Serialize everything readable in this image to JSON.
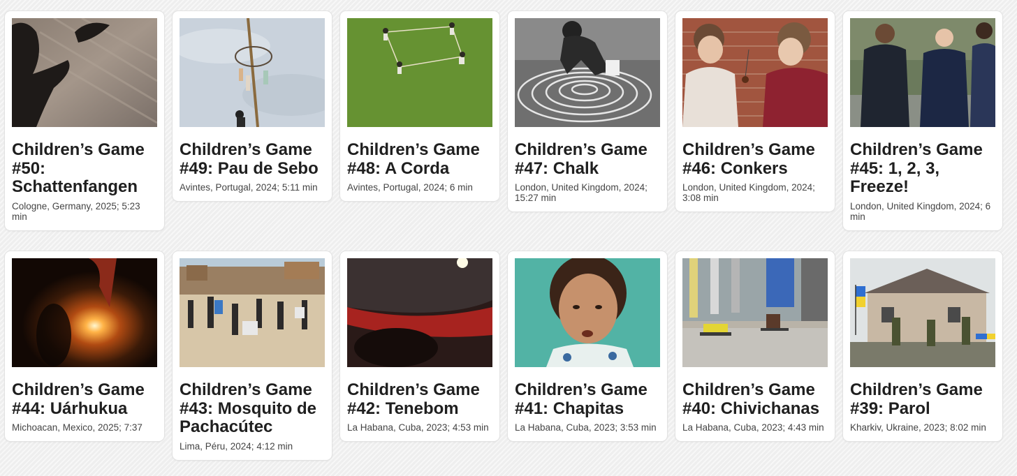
{
  "games": [
    {
      "title": "Children’s Game #50: Schattenfangen",
      "meta": "Cologne, Germany, 2025; 5:23 min",
      "thumbnail": "shadow-on-cobblestones"
    },
    {
      "title": "Children’s Game #49: Pau de Sebo",
      "meta": "Avintes, Portugal, 2024; 5:11 min",
      "thumbnail": "greased-pole-climb"
    },
    {
      "title": "Children’s Game #48: A Corda",
      "meta": "Avintes, Portugal, 2024; 6 min",
      "thumbnail": "rope-game-on-grass"
    },
    {
      "title": "Children’s Game #47: Chalk",
      "meta": "London, United Kingdom, 2024; 15:27 min",
      "thumbnail": "chalk-spiral-drawing"
    },
    {
      "title": "Children’s Game #46: Conkers",
      "meta": "London, United Kingdom, 2024; 3:08 min",
      "thumbnail": "girls-playing-conkers"
    },
    {
      "title": "Children’s Game #45: 1, 2, 3, Freeze!",
      "meta": "London, United Kingdom, 2024; 6 min",
      "thumbnail": "boys-in-school-uniform"
    },
    {
      "title": "Children’s Game #44: Uárhukua",
      "meta": "Michoacan, Mexico, 2025; 7:37",
      "thumbnail": "fireball-at-night"
    },
    {
      "title": "Children’s Game #43: Mosquito de Pachacútec",
      "meta": "Lima, Péru, 2024; 4:12 min",
      "thumbnail": "kids-on-sandy-hill"
    },
    {
      "title": "Children’s Game #42: Tenebom",
      "meta": "La Habana, Cuba, 2023; 4:53 min",
      "thumbnail": "under-car-view"
    },
    {
      "title": "Children’s Game #41: Chapitas",
      "meta": "La Habana, Cuba, 2023; 3:53 min",
      "thumbnail": "girl-close-up"
    },
    {
      "title": "Children’s Game #40: Chivichanas",
      "meta": "La Habana, Cuba, 2023; 4:43 min",
      "thumbnail": "street-go-karts"
    },
    {
      "title": "Children’s Game #39: Parol",
      "meta": "Kharkiv, Ukraine, 2023; 8:02 min",
      "thumbnail": "soldiers-by-house-ukraine-flag"
    }
  ]
}
